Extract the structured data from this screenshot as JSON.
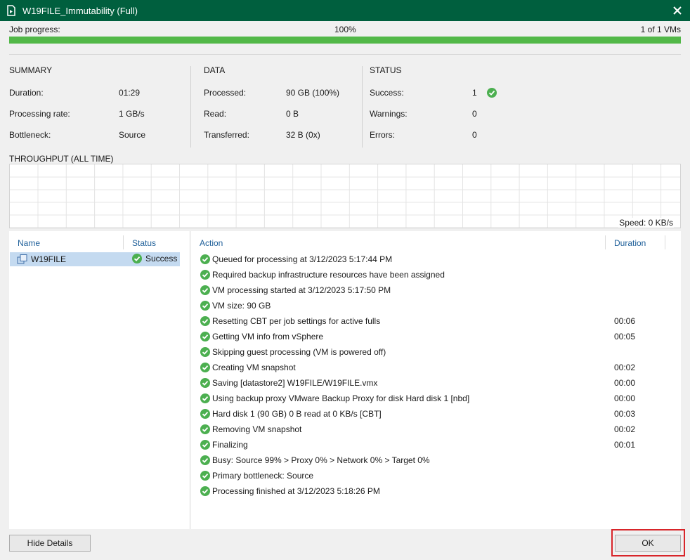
{
  "window": {
    "title": "W19FILE_Immutability (Full)"
  },
  "progress": {
    "label": "Job progress:",
    "percent_text": "100%",
    "percent": 100,
    "vms": "1 of 1 VMs"
  },
  "summary": {
    "title": "SUMMARY",
    "rows": [
      {
        "label": "Duration:",
        "value": "01:29"
      },
      {
        "label": "Processing rate:",
        "value": "1 GB/s"
      },
      {
        "label": "Bottleneck:",
        "value": "Source"
      }
    ]
  },
  "data": {
    "title": "DATA",
    "rows": [
      {
        "label": "Processed:",
        "value": "90 GB (100%)"
      },
      {
        "label": "Read:",
        "value": "0 B"
      },
      {
        "label": "Transferred:",
        "value": "32 B (0x)"
      }
    ]
  },
  "status": {
    "title": "STATUS",
    "rows": [
      {
        "label": "Success:",
        "value": "1"
      },
      {
        "label": "Warnings:",
        "value": "0"
      },
      {
        "label": "Errors:",
        "value": "0"
      }
    ]
  },
  "throughput": {
    "title": "THROUGHPUT (ALL TIME)",
    "speed": "Speed: 0 KB/s"
  },
  "vm_table": {
    "headers": {
      "name": "Name",
      "status": "Status"
    },
    "rows": [
      {
        "name": "W19FILE",
        "status": "Success"
      }
    ]
  },
  "actions": {
    "headers": {
      "action": "Action",
      "duration": "Duration"
    },
    "rows": [
      {
        "text": "Queued for processing at 3/12/2023 5:17:44 PM",
        "duration": ""
      },
      {
        "text": "Required backup infrastructure resources have been assigned",
        "duration": ""
      },
      {
        "text": "VM processing started at 3/12/2023 5:17:50 PM",
        "duration": ""
      },
      {
        "text": "VM size: 90 GB",
        "duration": ""
      },
      {
        "text": "Resetting CBT per job settings for active fulls",
        "duration": "00:06"
      },
      {
        "text": "Getting VM info from vSphere",
        "duration": "00:05"
      },
      {
        "text": "Skipping guest processing (VM is powered off)",
        "duration": ""
      },
      {
        "text": "Creating VM snapshot",
        "duration": "00:02"
      },
      {
        "text": "Saving [datastore2] W19FILE/W19FILE.vmx",
        "duration": "00:00"
      },
      {
        "text": "Using backup proxy VMware Backup Proxy for disk Hard disk 1 [nbd]",
        "duration": "00:00"
      },
      {
        "text": "Hard disk 1 (90 GB) 0 B read at 0 KB/s [CBT]",
        "duration": "00:03"
      },
      {
        "text": "Removing VM snapshot",
        "duration": "00:02"
      },
      {
        "text": "Finalizing",
        "duration": "00:01"
      },
      {
        "text": "Busy: Source 99% > Proxy 0% > Network 0% > Target 0%",
        "duration": ""
      },
      {
        "text": "Primary bottleneck: Source",
        "duration": ""
      },
      {
        "text": "Processing finished at 3/12/2023 5:18:26 PM",
        "duration": ""
      }
    ]
  },
  "buttons": {
    "hide_details": "Hide Details",
    "ok": "OK"
  },
  "colors": {
    "titlebar": "#005f3e",
    "progress": "#52b848",
    "success": "#4caf50",
    "link": "#1e5f99",
    "selection": "#c4daf0",
    "highlight": "#d8252a"
  }
}
